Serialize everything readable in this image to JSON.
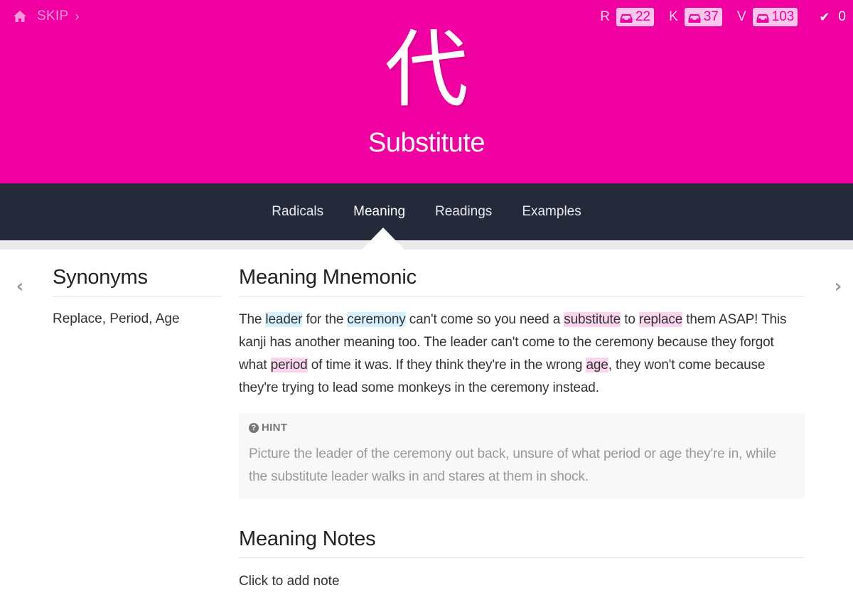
{
  "header": {
    "skip_label": "SKIP",
    "skip_chevron": "›",
    "kanji": "代",
    "meaning": "Substitute",
    "background_color": "#f000a1",
    "queues": [
      {
        "letter": "R",
        "count": "22"
      },
      {
        "letter": "K",
        "count": "37"
      },
      {
        "letter": "V",
        "count": "103"
      }
    ],
    "done_count": "0"
  },
  "nav": {
    "tabs": [
      {
        "label": "Radicals",
        "active": false
      },
      {
        "label": "Meaning",
        "active": true
      },
      {
        "label": "Readings",
        "active": false
      },
      {
        "label": "Examples",
        "active": false
      }
    ],
    "background_color": "#252a3a"
  },
  "arrows": {
    "prev": "‹",
    "next": "›"
  },
  "synonyms": {
    "title": "Synonyms",
    "value": "Replace, Period, Age"
  },
  "mnemonic": {
    "title": "Meaning Mnemonic",
    "segments": [
      {
        "text": "The ",
        "type": "plain"
      },
      {
        "text": "leader",
        "type": "radical"
      },
      {
        "text": " for the ",
        "type": "plain"
      },
      {
        "text": "ceremony",
        "type": "radical"
      },
      {
        "text": " can't come so you need a ",
        "type": "plain"
      },
      {
        "text": "substitute",
        "type": "kanji"
      },
      {
        "text": " to ",
        "type": "plain"
      },
      {
        "text": "replace",
        "type": "kanji"
      },
      {
        "text": " them ASAP! This kanji has another meaning too. The leader can't come to the ceremony because they forgot what ",
        "type": "plain"
      },
      {
        "text": "period",
        "type": "kanji"
      },
      {
        "text": " of time it was. If they think they're in the wrong ",
        "type": "plain"
      },
      {
        "text": "age",
        "type": "kanji"
      },
      {
        "text": ", they won't come because they're trying to lead some monkeys in the ceremony instead.",
        "type": "plain"
      }
    ],
    "highlight_colors": {
      "radical": "#d6f1ff",
      "kanji": "#fbd4ee"
    }
  },
  "hint": {
    "label": "HINT",
    "text": "Picture the leader of the ceremony out back, unsure of what period or age they're in, while the substitute leader walks in and stares at them in shock."
  },
  "notes": {
    "title": "Meaning Notes",
    "add_label": "Click to add note"
  }
}
